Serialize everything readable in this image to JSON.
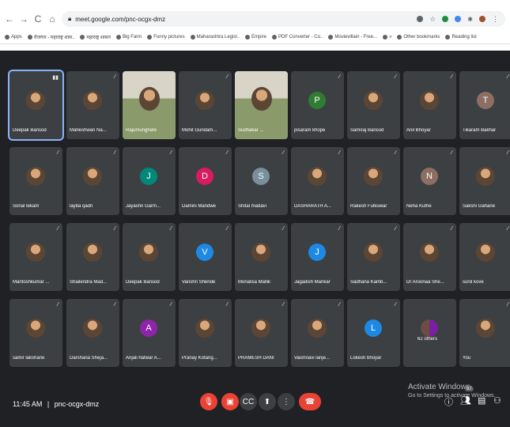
{
  "browser": {
    "url": "meet.google.com/pnc-ocgx-dmz",
    "bookmarks": [
      "Apps",
      "रोजगार - महाराष्ट्र शास..",
      "महाराष्ट्र शासन",
      "Big Farm",
      "Funny pictures",
      "Maharashtra Legisl..",
      "Empire",
      "PDF Converter - Co..",
      "Movievillain - Free...",
      "»",
      "Other bookmarks",
      "Reading list"
    ]
  },
  "participants": [
    {
      "name": "Deepak Bansod",
      "type": "photo",
      "active": true,
      "icon": "speaking-icon"
    },
    {
      "name": "Maheshwari Na...",
      "type": "photo"
    },
    {
      "name": "Rajumunghate",
      "type": "video"
    },
    {
      "name": "Mohit Gundam...",
      "type": "photo"
    },
    {
      "name": "Sudhakar ...",
      "type": "video"
    },
    {
      "name": "pisaram khope",
      "type": "letter",
      "letter": "P",
      "color": "#2e7d32"
    },
    {
      "name": "Samiraj Bansod",
      "type": "photo"
    },
    {
      "name": "Anil Bhoyar",
      "type": "photo"
    },
    {
      "name": "Tikaram Bakhar",
      "type": "letter",
      "letter": "T",
      "color": "#8d6e63"
    },
    {
      "name": "Sonal tekam",
      "type": "photo"
    },
    {
      "name": "layba qadri",
      "type": "photo"
    },
    {
      "name": "Jayashri Garm...",
      "type": "letter",
      "letter": "J",
      "color": "#00897b"
    },
    {
      "name": "Damini Mandwe",
      "type": "letter",
      "letter": "D",
      "color": "#d81b60"
    },
    {
      "name": "Shital madavi",
      "type": "letter",
      "letter": "S",
      "color": "#78909c"
    },
    {
      "name": "DASHARATH A...",
      "type": "photo"
    },
    {
      "name": "Rakesh Fulkuwar",
      "type": "photo"
    },
    {
      "name": "Neha Kuthe",
      "type": "letter",
      "letter": "N",
      "color": "#8d6e63"
    },
    {
      "name": "Sakshi Gahane",
      "type": "photo"
    },
    {
      "name": "Mantoshkumar ...",
      "type": "photo"
    },
    {
      "name": "Shailendra Mad...",
      "type": "photo"
    },
    {
      "name": "Deepak Bansod",
      "type": "photo"
    },
    {
      "name": "Vanshri Shende",
      "type": "letter",
      "letter": "V",
      "color": "#1e88e5"
    },
    {
      "name": "Monalisa Mallik",
      "type": "photo"
    },
    {
      "name": "Jagadish Mankar",
      "type": "letter",
      "letter": "J",
      "color": "#1e88e5"
    },
    {
      "name": "Sadhana Kamb...",
      "type": "photo"
    },
    {
      "name": "Dr Aroonaa She...",
      "type": "photo"
    },
    {
      "name": "sunil kove",
      "type": "photo"
    },
    {
      "name": "samir lakshane",
      "type": "photo"
    },
    {
      "name": "Darshana Sheja...",
      "type": "photo"
    },
    {
      "name": "Anjali hatwar A...",
      "type": "letter",
      "letter": "A",
      "color": "#8e24aa"
    },
    {
      "name": "Pranay Kotang...",
      "type": "photo"
    },
    {
      "name": "PRAMESH DANI",
      "type": "photo"
    },
    {
      "name": "Vaishnavi lanje...",
      "type": "photo"
    },
    {
      "name": "Lokesh bhoyar",
      "type": "letter",
      "letter": "L",
      "color": "#1e88e5"
    },
    {
      "name": "62 others",
      "type": "others"
    },
    {
      "name": "You",
      "type": "photo"
    }
  ],
  "footer": {
    "time": "11:45 AM",
    "separator": "|",
    "meeting_code": "pnc-ocgx-dmz",
    "badge_count": "97",
    "watermark_title": "Activate Windows",
    "watermark_sub": "Go to Settings to activate Windows."
  },
  "colors": {
    "mic_off": "#ea4335",
    "hangup": "#ea4335",
    "tile": "#3c4043",
    "background": "#202124"
  }
}
